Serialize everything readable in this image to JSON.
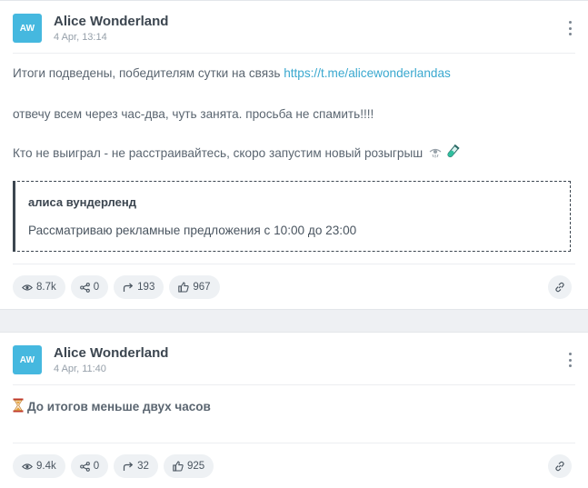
{
  "posts": [
    {
      "avatar_initials": "AW",
      "author": "Alice Wonderland",
      "date": "4 Apr, 13:14",
      "line1_text": "Итоги подведены, победителям сутки на связь ",
      "line1_link": "https://t.me/alicewonderlandas",
      "line2": "отвечу всем через час-два, чуть занята. просьба не спамить!!!!",
      "line3": "Кто не выиграл - не расстраивайтесь, скоро запустим новый розыгрыш",
      "quote_title": "алиса вундерленд",
      "quote_text": "Рассматриваю рекламные предложения с 10:00 до 23:00",
      "stats": {
        "views": "8.7k",
        "shares": "0",
        "forwards": "193",
        "likes": "967"
      }
    },
    {
      "avatar_initials": "AW",
      "author": "Alice Wonderland",
      "date": "4 Apr, 11:40",
      "headline": "До итогов меньше двух часов",
      "stats": {
        "views": "9.4k",
        "shares": "0",
        "forwards": "32",
        "likes": "925"
      }
    }
  ],
  "colors": {
    "accent": "#45b8df",
    "link": "#3aa8cf",
    "chip_bg": "#eef1f4"
  }
}
